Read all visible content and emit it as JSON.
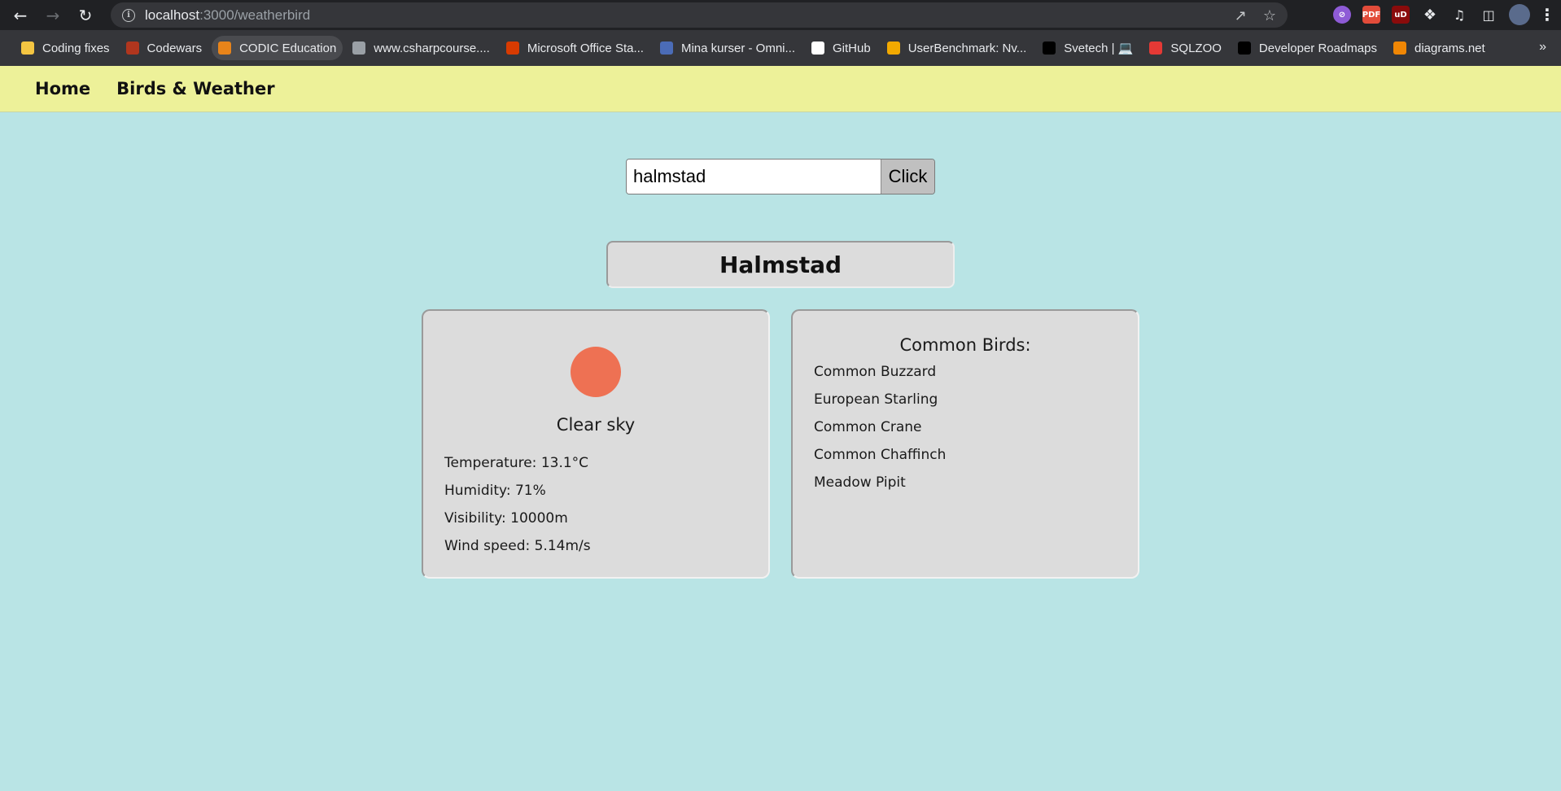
{
  "browser": {
    "url_host": "localhost",
    "url_path": ":3000/weatherbird",
    "bookmarks": [
      {
        "label": "Coding fixes",
        "color": "#f4c542"
      },
      {
        "label": "Codewars",
        "color": "#b1361e"
      },
      {
        "label": "CODIC Education",
        "color": "#e8841a"
      },
      {
        "label": "www.csharpcourse....",
        "color": "#9aa0a6"
      },
      {
        "label": "Microsoft Office Sta...",
        "color": "#d83b01"
      },
      {
        "label": "Mina kurser - Omni...",
        "color": "#4b6cb7"
      },
      {
        "label": "GitHub",
        "color": "#ffffff"
      },
      {
        "label": "UserBenchmark: Nv...",
        "color": "#f2a900"
      },
      {
        "label": "Svetech | 💻",
        "color": "#000000"
      },
      {
        "label": "SQLZOO",
        "color": "#e53935"
      },
      {
        "label": "Developer Roadmaps",
        "color": "#000000"
      },
      {
        "label": "diagrams.net",
        "color": "#f08705"
      }
    ]
  },
  "nav": {
    "home": "Home",
    "birds_weather": "Birds & Weather"
  },
  "search": {
    "value": "halmstad",
    "button": "Click"
  },
  "city": "Halmstad",
  "weather": {
    "icon": "sun-icon",
    "icon_color": "#ee7153",
    "description": "Clear sky",
    "temperature": "Temperature: 13.1°C",
    "humidity": "Humidity: 71%",
    "visibility": "Visibility: 10000m",
    "wind": "Wind speed: 5.14m/s"
  },
  "birds": {
    "title": "Common Birds:",
    "items": [
      "Common Buzzard",
      "European Starling",
      "Common Crane",
      "Common Chaffinch",
      "Meadow Pipit"
    ]
  }
}
